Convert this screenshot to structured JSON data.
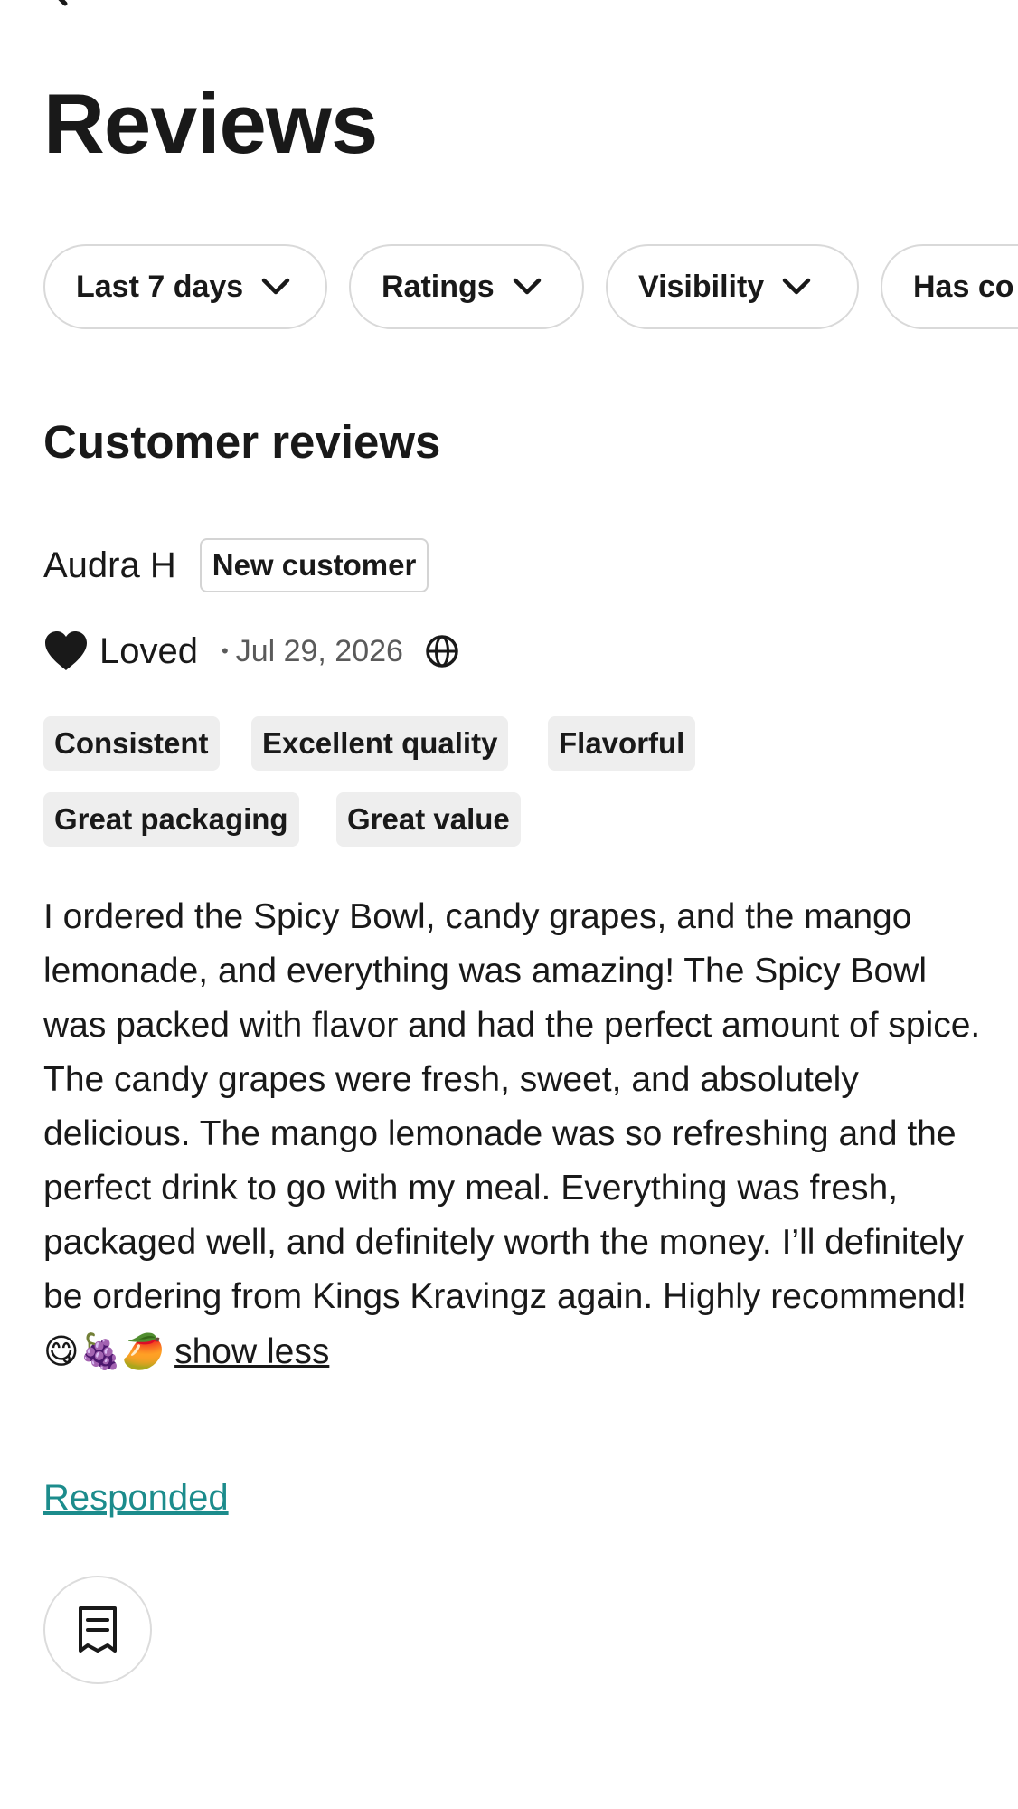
{
  "header": {
    "back_icon": "arrow-left-icon",
    "title": "Reviews"
  },
  "filters": [
    {
      "label": "Last 7 days",
      "icon": "chevron-down-icon"
    },
    {
      "label": "Ratings",
      "icon": "chevron-down-icon"
    },
    {
      "label": "Visibility",
      "icon": "chevron-down-icon"
    },
    {
      "label": "Has co",
      "icon": ""
    }
  ],
  "section": {
    "title": "Customer reviews"
  },
  "review": {
    "reviewer_name": "Audra H",
    "badge": "New customer",
    "rating_icon": "heart-icon",
    "rating_label": "Loved",
    "separator": "•",
    "date": "Jul 29, 2026",
    "visibility_icon": "globe-icon",
    "tags": [
      "Consistent",
      "Excellent quality",
      "Flavorful",
      "Great packaging",
      "Great value"
    ],
    "body": "I ordered the Spicy Bowl, candy grapes, and the mango lemonade, and everything was amazing! The Spicy Bowl was packed with flavor and had the perfect amount of spice. The candy grapes were fresh, sweet, and absolutely delicious. The mango lemonade was so refreshing and the perfect drink to go with my meal. Everything was fresh, packaged well, and definitely worth the money. I’ll definitely be ordering from Kings Kravingz again. Highly recommend! ",
    "emojis": "😋🍇🥭",
    "show_less": "show less",
    "responded_label": "Responded",
    "receipt_icon": "receipt-icon"
  },
  "colors": {
    "text": "#191919",
    "muted": "#5a5a5a",
    "link_teal": "#1c8c8c",
    "tag_bg": "#eeeeee",
    "border": "#d9d9d9"
  }
}
